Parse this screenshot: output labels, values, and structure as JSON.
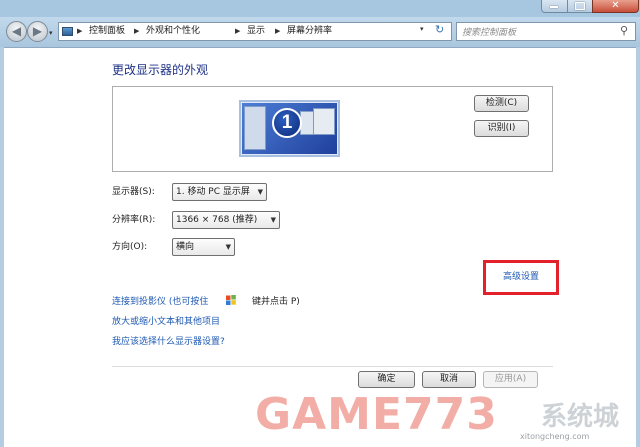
{
  "window": {
    "close_glyph": "✕"
  },
  "nav": {
    "back_glyph": "◀",
    "forward_glyph": "▶",
    "dropdown_glyph": "▾"
  },
  "address": {
    "icon": "control-panel-icon",
    "breadcrumbs": [
      "控制面板",
      "外观和个性化",
      "显示",
      "屏幕分辨率"
    ],
    "separator": "▶",
    "dropdown_glyph": "▾",
    "refresh_glyph": "↻"
  },
  "search": {
    "placeholder": "搜索控制面板",
    "icon_glyph": "⚲"
  },
  "page": {
    "title": "更改显示器的外观"
  },
  "monitor": {
    "number": "1",
    "detect_label": "检测(C)",
    "identify_label": "识别(I)"
  },
  "form": {
    "display_label": "显示器(S):",
    "display_value": "1. 移动 PC 显示屏",
    "resolution_label": "分辨率(R):",
    "resolution_value": "1366 × 768 (推荐)",
    "orientation_label": "方向(O):",
    "orientation_value": "横向",
    "arrow_glyph": "▼"
  },
  "links": {
    "advanced": "高级设置",
    "projector_prefix": "连接到投影仪 (也可按住",
    "projector_suffix": "键并点击 P)",
    "text_size": "放大或缩小文本和其他项目",
    "which_settings": "我应该选择什么显示器设置?"
  },
  "buttons": {
    "ok": "确定",
    "cancel": "取消",
    "apply": "应用(A)"
  },
  "watermark": {
    "logo_text": "GAME773",
    "logo_cn": "系统城",
    "url": "xitongcheng.com"
  },
  "colors": {
    "highlight_box": "#e2212a",
    "link": "#1f5ab3",
    "title": "#1e3287"
  }
}
